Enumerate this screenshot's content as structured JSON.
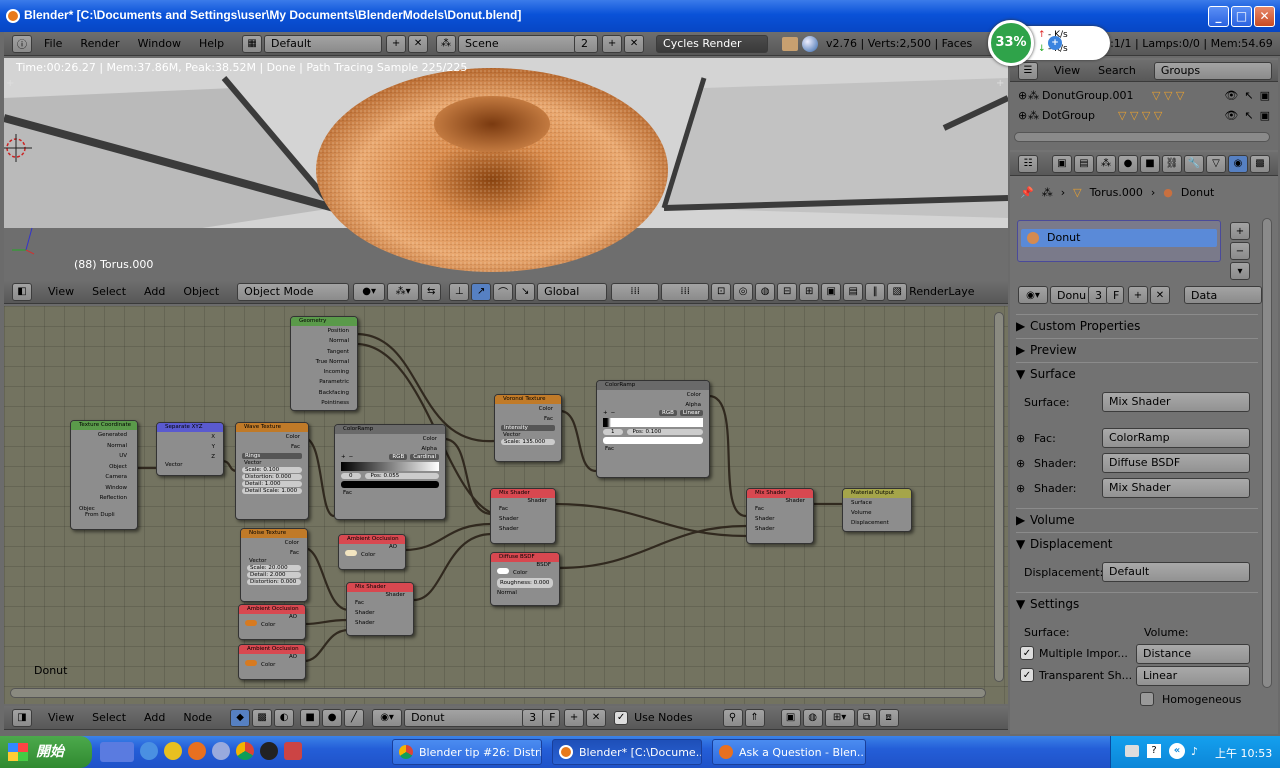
{
  "window": {
    "title": "Blender* [C:\\Documents and Settings\\user\\My Documents\\BlenderModels\\Donut.blend]"
  },
  "netmeter": {
    "percent": "33%",
    "up": "- K/s",
    "down": "- K/s"
  },
  "info_header": {
    "menus": [
      "File",
      "Render",
      "Window",
      "Help"
    ],
    "layout": "Default",
    "scene": "Scene",
    "scene_users": "2",
    "engine": "Cycles Render",
    "stats": "v2.76 | Verts:2,500 | Faces",
    "stats_right": "cts:1/1 | Lamps:0/0 | Mem:54.69"
  },
  "viewport": {
    "render_status": "Time:00:26.27 | Mem:37.86M, Peak:38.52M | Done | Path Tracing Sample 225/225",
    "object_label": "(88) Torus.000"
  },
  "view3d_header": {
    "menus": [
      "View",
      "Select",
      "Add",
      "Object"
    ],
    "mode": "Object Mode",
    "orientation": "Global",
    "render_layer": "RenderLaye"
  },
  "node_editor": {
    "label": "Donut",
    "nodes": {
      "geometry": {
        "title": "Geometry",
        "outputs": [
          "Position",
          "Normal",
          "Tangent",
          "True Normal",
          "Incoming",
          "Parametric",
          "Backfacing",
          "Pointiness"
        ]
      },
      "texcoord": {
        "title": "Texture Coordinate",
        "outputs": [
          "Generated",
          "Normal",
          "UV",
          "Object",
          "Camera",
          "Window",
          "Reflection"
        ],
        "object_label": "Objec",
        "from_dupli": "From Dupli"
      },
      "separate": {
        "title": "Separate XYZ",
        "outputs": [
          "X",
          "Y",
          "Z"
        ],
        "input": "Vector"
      },
      "wave": {
        "title": "Wave Texture",
        "outputs": [
          "Color",
          "Fac"
        ],
        "type": "Rings",
        "vector": "Vector",
        "fields": [
          "Scale: 0.100",
          "Distortion: 0.000",
          "Detail: 1.000",
          "Detail Scale: 1.000"
        ]
      },
      "colorramp1": {
        "title": "ColorRamp",
        "outputs": [
          "Color",
          "Alpha"
        ],
        "mode": "RGB",
        "interp": "Cardinal",
        "index": "0",
        "pos": "Pos: 0.055",
        "input": "Fac"
      },
      "voronoi": {
        "title": "Voronoi Texture",
        "outputs": [
          "Color",
          "Fac"
        ],
        "coloring": "Intensity",
        "vector": "Vector",
        "scale": "Scale: 135.000"
      },
      "colorramp2": {
        "title": "ColorRamp",
        "outputs": [
          "Color",
          "Alpha"
        ],
        "mode": "RGB",
        "interp": "Linear",
        "index": "1",
        "pos": "Pos: 0.100",
        "input": "Fac"
      },
      "mix1": {
        "title": "Mix Shader",
        "output": "Shader",
        "inputs": [
          "Fac",
          "Shader",
          "Shader"
        ]
      },
      "diffuse": {
        "title": "Diffuse BSDF",
        "output": "BSDF",
        "inputs": [
          "Color",
          "Roughness: 0.000",
          "Normal"
        ]
      },
      "mix2": {
        "title": "Mix Shader",
        "output": "Shader",
        "inputs": [
          "Fac",
          "Shader",
          "Shader"
        ]
      },
      "output": {
        "title": "Material Output",
        "inputs": [
          "Surface",
          "Volume",
          "Displacement"
        ]
      },
      "noise": {
        "title": "Noise Texture",
        "outputs": [
          "Color",
          "Fac"
        ],
        "vector": "Vector",
        "fields": [
          "Scale: 20.000",
          "Detail: 2.000",
          "Distortion: 0.000"
        ]
      },
      "ao1": {
        "title": "Ambient Occlusion",
        "output": "AO",
        "input": "Color"
      },
      "ao2": {
        "title": "Ambient Occlusion",
        "output": "AO",
        "input": "Color"
      },
      "ao3": {
        "title": "Ambient Occlusion",
        "output": "AO",
        "input": "Color"
      },
      "mix3": {
        "title": "Mix Shader",
        "output": "Shader",
        "inputs": [
          "Fac",
          "Shader",
          "Shader"
        ]
      }
    }
  },
  "node_header": {
    "menus": [
      "View",
      "Select",
      "Add",
      "Node"
    ],
    "material": "Donut",
    "users": "3",
    "fake": "F",
    "use_nodes": "Use Nodes"
  },
  "outliner": {
    "menus": [
      "View",
      "Search"
    ],
    "display": "Groups",
    "items": [
      "DonutGroup.001",
      "DotGroup"
    ]
  },
  "properties": {
    "breadcrumb": [
      "Torus.000",
      "Donut"
    ],
    "slot": "Donut",
    "mat_name": "Donu",
    "mat_users": "3",
    "mat_fake": "F",
    "link": "Data",
    "panels": {
      "custom": "Custom Properties",
      "preview": "Preview",
      "surface": "Surface",
      "volume": "Volume",
      "displacement": "Displacement",
      "settings": "Settings"
    },
    "surface_label": "Surface:",
    "surface_value": "Mix Shader",
    "fac_label": "Fac:",
    "fac_value": "ColorRamp",
    "shader1_label": "Shader:",
    "shader1_value": "Diffuse BSDF",
    "shader2_label": "Shader:",
    "shader2_value": "Mix Shader",
    "disp_label": "Displacement:",
    "disp_value": "Default",
    "settings_surface": "Surface:",
    "settings_volume": "Volume:",
    "mis": "Multiple Impor...",
    "transparent": "Transparent Sh...",
    "vol_sampling": "Distance",
    "vol_interp": "Linear",
    "homogeneous": "Homogeneous"
  },
  "taskbar": {
    "start": "開始",
    "tasks": [
      "Blender tip #26: Distri...",
      "Blender* [C:\\Docume...",
      "Ask a Question - Blen..."
    ],
    "clock": "上午 10:53"
  }
}
